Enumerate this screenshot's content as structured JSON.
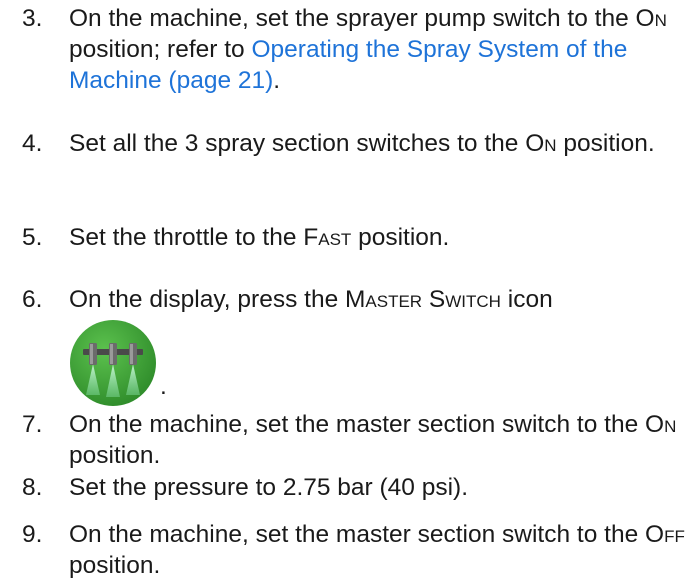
{
  "steps": [
    {
      "number": "3.",
      "text_before": "On the machine, set the sprayer pump switch to the ",
      "keyword": "On",
      "text_middle": " position; refer to ",
      "link": "Operating the Spray System of the Machine (page 21)",
      "text_after": "."
    },
    {
      "number": "4.",
      "text_before": "Set all the 3 spray section switches to the ",
      "keyword": "On",
      "text_after": " position."
    },
    {
      "number": "5.",
      "text_before": "Set the throttle to the ",
      "keyword": "Fast",
      "text_after": " position."
    },
    {
      "number": "6.",
      "text_before": "On the display, press the ",
      "keyword": "Master Switch",
      "text_after": " icon",
      "icon": "master-switch-spray-boom-icon",
      "trailing": "."
    },
    {
      "number": "7.",
      "text_before": "On the machine, set the master section switch to the ",
      "keyword": "On",
      "text_after": " position."
    },
    {
      "number": "8.",
      "text": "Set the pressure to 2.75 bar (40 psi)."
    },
    {
      "number": "9.",
      "text_before": "On the machine, set the master section switch to the ",
      "keyword": "Off",
      "text_after": " position."
    }
  ],
  "colors": {
    "text": "#1a1a1a",
    "link": "#1e73d8",
    "icon_green": "#3fa535",
    "icon_spray": "#9be3b4"
  }
}
